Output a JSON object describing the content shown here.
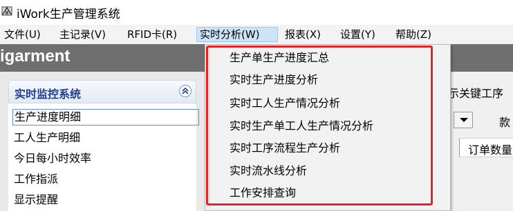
{
  "window": {
    "title": "iWork生产管理系统",
    "icon": "app-logo-icon"
  },
  "menubar": {
    "items": [
      {
        "label": "文件(U)"
      },
      {
        "label": "主记录(V)"
      },
      {
        "label": "RFID卡(R)"
      },
      {
        "label": "实时分析(W)",
        "active": true
      },
      {
        "label": "报表(X)"
      },
      {
        "label": "设置(Y)"
      },
      {
        "label": "帮助(Z)"
      }
    ]
  },
  "banner": {
    "text": "igarment"
  },
  "left_panel": {
    "title": "实时监控系统",
    "collapse_icon": "double-chevron-up-icon",
    "items": [
      {
        "label": "生产进度明细",
        "selected": true
      },
      {
        "label": "工人生产明细"
      },
      {
        "label": "今日每小时效率"
      },
      {
        "label": "工作指派"
      },
      {
        "label": "显示提醒"
      }
    ]
  },
  "right_panel": {
    "key_process_label": "示关键工序",
    "style_label": "款",
    "order_qty_header": "订单数量"
  },
  "dropdown": {
    "items": [
      {
        "label": "生产单生产进度汇总"
      },
      {
        "label": "实时生产进度分析"
      },
      {
        "label": "实时工人生产情况分析"
      },
      {
        "label": "实时生产单工人生产情况分析"
      },
      {
        "label": "实时工序流程生产分析"
      },
      {
        "label": "实时流水线分析"
      },
      {
        "label": "工作安排查询"
      }
    ]
  },
  "colors": {
    "banner_bg": "#6f6f6f",
    "highlight": "#e52226",
    "menu_active_bg": "#cce4f7",
    "panel_title": "#1f3f8f"
  }
}
